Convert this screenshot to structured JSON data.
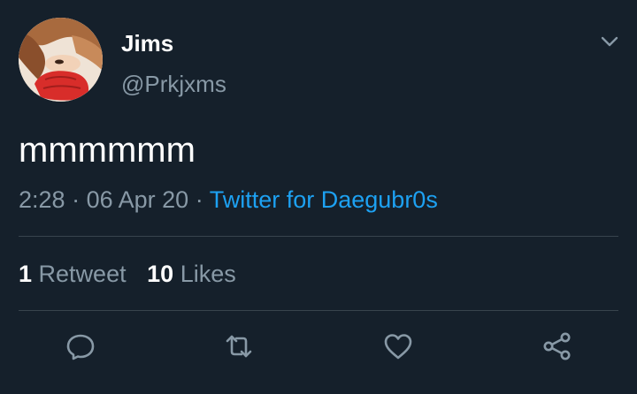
{
  "user": {
    "display_name": "Jims",
    "handle": "@Prkjxms"
  },
  "tweet": {
    "text": "mmmmmm",
    "time": "2:28",
    "date": "06 Apr 20",
    "separator": "·",
    "source": "Twitter for Daegubr0s"
  },
  "stats": {
    "retweet_count": "1",
    "retweet_label": "Retweet",
    "like_count": "10",
    "like_label": "Likes"
  },
  "icons": {
    "menu": "chevron-down-icon",
    "reply": "reply-icon",
    "retweet": "retweet-icon",
    "like": "heart-icon",
    "share": "share-icon"
  },
  "colors": {
    "background": "#15202b",
    "primary_text": "#ffffff",
    "secondary_text": "#8899a6",
    "link": "#1da1f2",
    "divider": "#38444d"
  }
}
